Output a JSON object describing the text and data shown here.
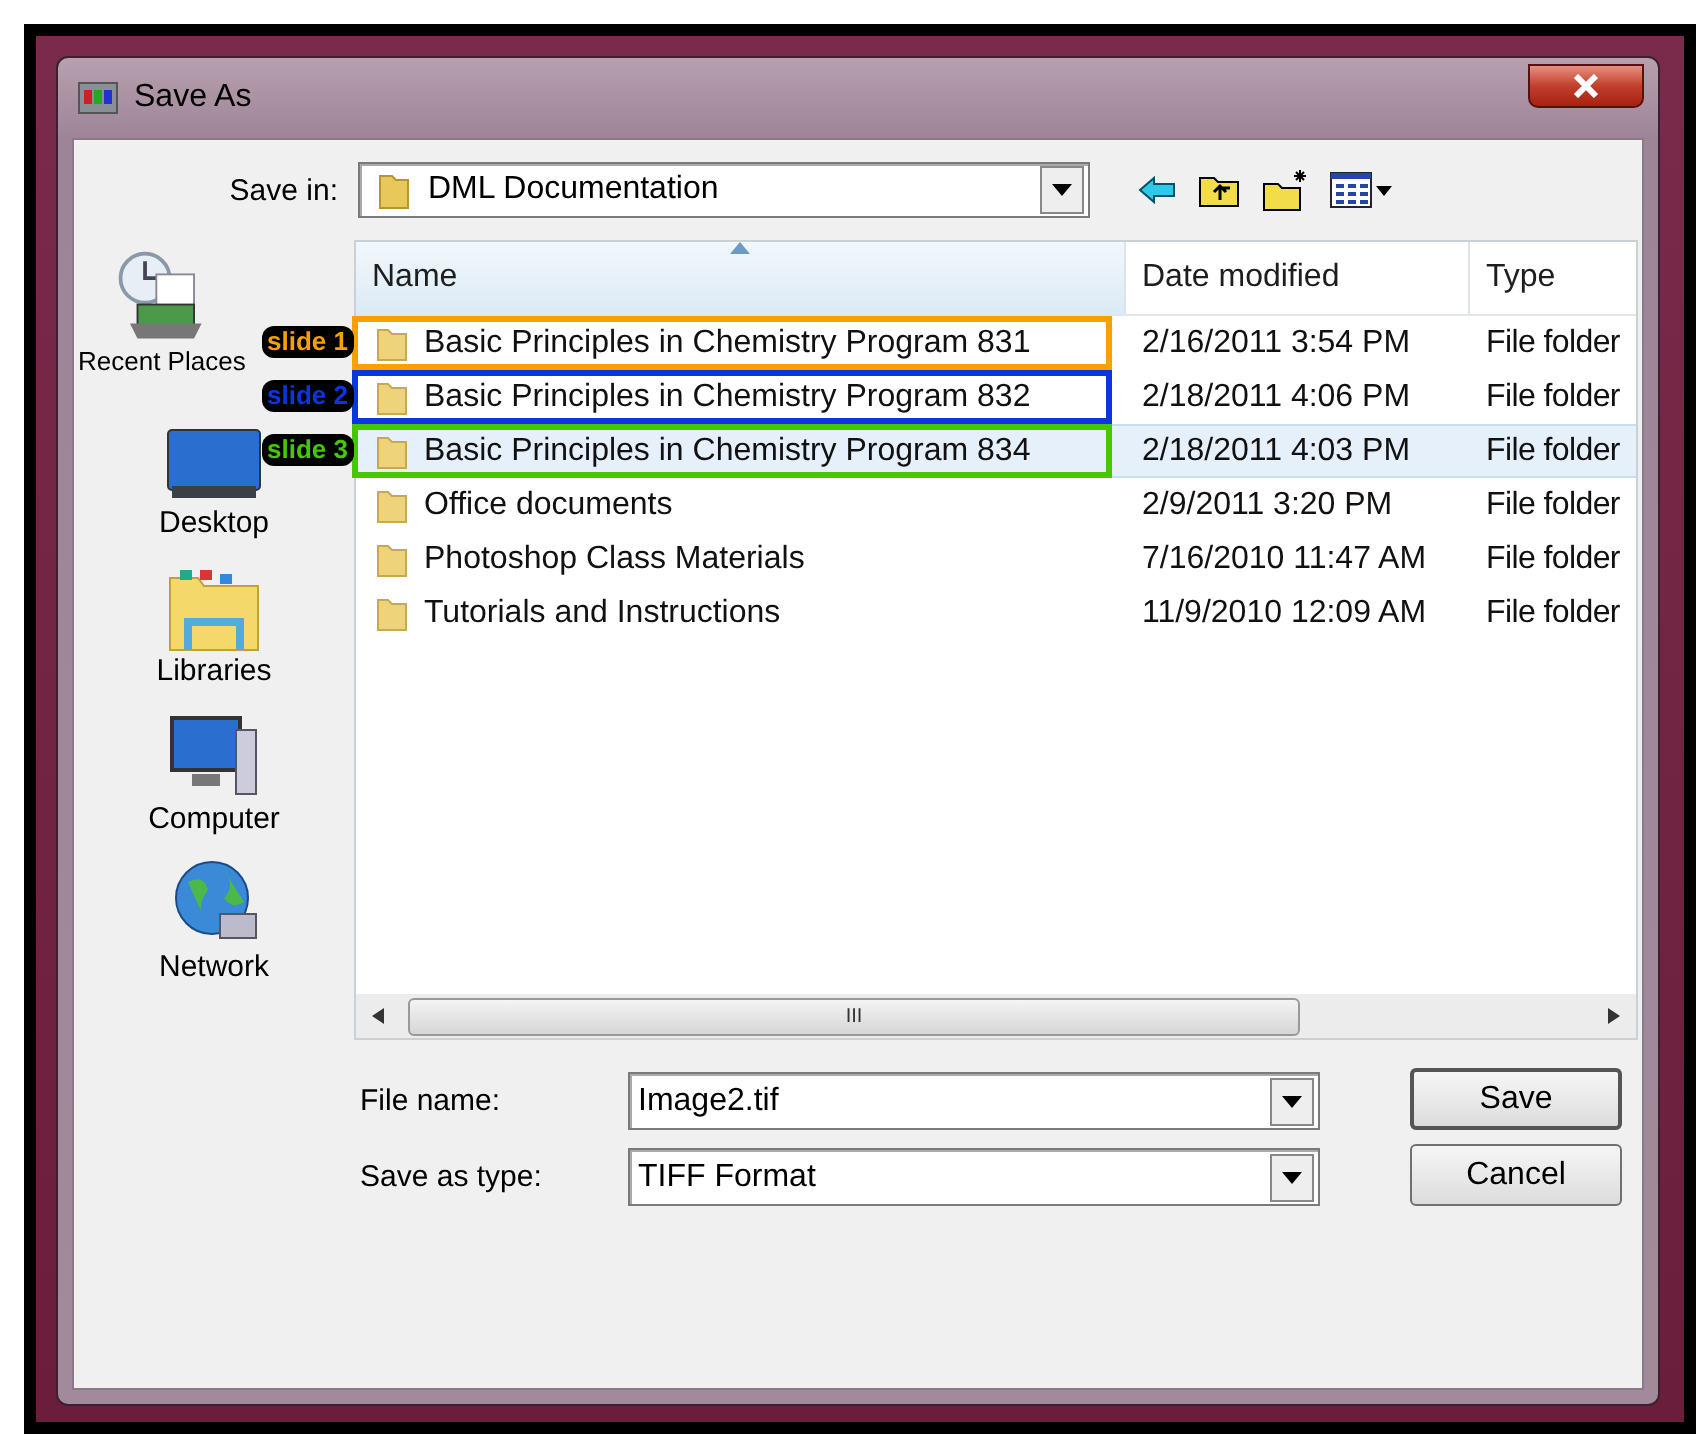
{
  "window": {
    "title": "Save As"
  },
  "save_in": {
    "label": "Save in:",
    "value": "DML Documentation"
  },
  "places": [
    {
      "label": "Recent Places",
      "kind": "recent"
    },
    {
      "label": "Desktop",
      "kind": "desktop"
    },
    {
      "label": "Libraries",
      "kind": "libraries"
    },
    {
      "label": "Computer",
      "kind": "computer"
    },
    {
      "label": "Network",
      "kind": "network"
    }
  ],
  "table": {
    "columns": [
      "Name",
      "Date modified",
      "Type"
    ],
    "rows": [
      {
        "name": "Basic Principles in Chemistry Program 831",
        "date": "2/16/2011 3:54 PM",
        "type": "File folder",
        "selected": false,
        "annotation": {
          "label": "slide 1",
          "color": "#f7a000"
        }
      },
      {
        "name": "Basic Principles in Chemistry Program 832",
        "date": "2/18/2011 4:06 PM",
        "type": "File folder",
        "selected": false,
        "annotation": {
          "label": "slide 2",
          "color": "#0a36e0"
        }
      },
      {
        "name": "Basic Principles in Chemistry Program 834",
        "date": "2/18/2011 4:03 PM",
        "type": "File folder",
        "selected": true,
        "annotation": {
          "label": "slide 3",
          "color": "#45c800"
        }
      },
      {
        "name": "Office documents",
        "date": "2/9/2011 3:20 PM",
        "type": "File folder",
        "selected": false
      },
      {
        "name": "Photoshop Class Materials",
        "date": "7/16/2010 11:47 AM",
        "type": "File folder",
        "selected": false
      },
      {
        "name": "Tutorials and Instructions",
        "date": "11/9/2010 12:09 AM",
        "type": "File folder",
        "selected": false
      }
    ]
  },
  "scrollbar": {
    "thumb": "III"
  },
  "file_name": {
    "label": "File name:",
    "value": "Image2.tif"
  },
  "save_as_type": {
    "label": "Save as type:",
    "value": "TIFF Format"
  },
  "buttons": [
    "Save",
    "Cancel"
  ]
}
